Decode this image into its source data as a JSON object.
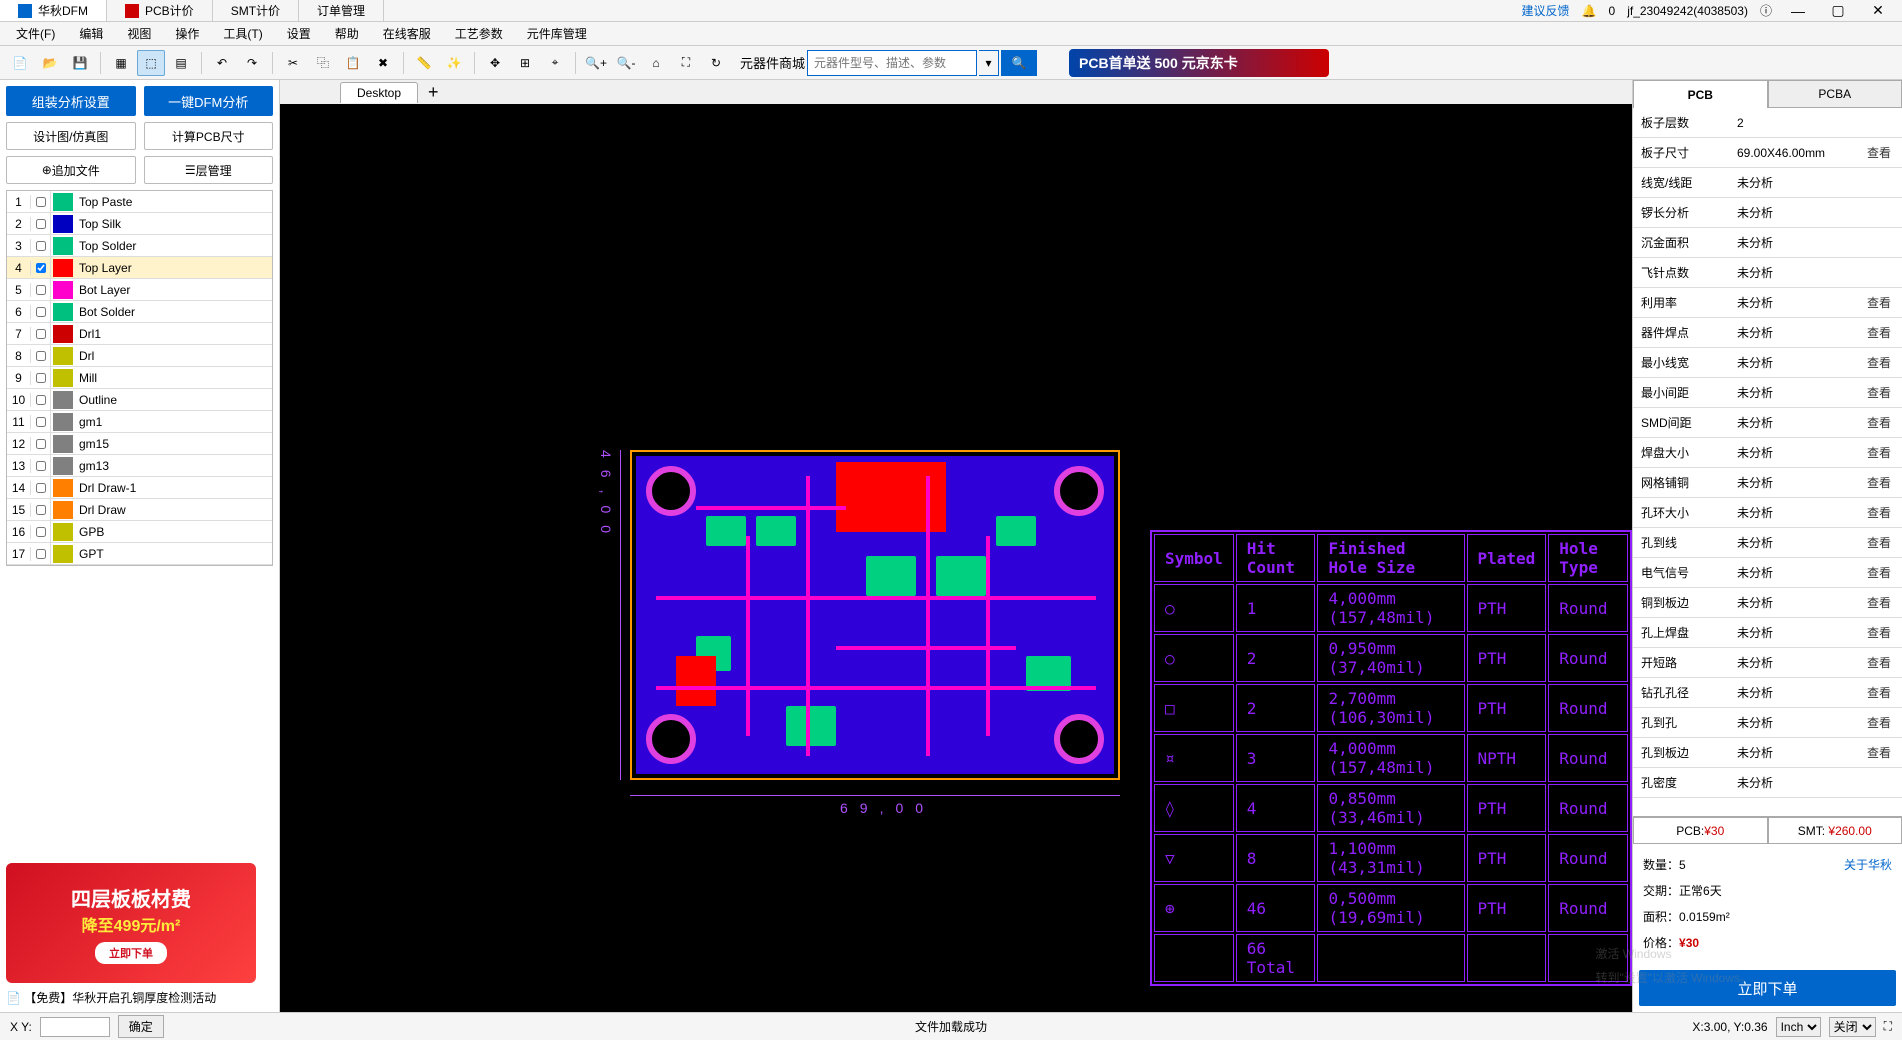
{
  "titlebar": {
    "tabs": [
      {
        "label": "华秋DFM",
        "icon": "blue"
      },
      {
        "label": "PCB计价",
        "icon": "red"
      },
      {
        "label": "SMT计价"
      },
      {
        "label": "订单管理"
      }
    ],
    "feedback": "建议反馈",
    "notif_count": "0",
    "user": "jf_23049242(4038503)"
  },
  "menus": [
    "文件(F)",
    "编辑",
    "视图",
    "操作",
    "工具(T)",
    "设置",
    "帮助",
    "在线客服",
    "工艺参数",
    "元件库管理"
  ],
  "toolbar": {
    "shop_label": "元器件商城",
    "search_placeholder": "元器件型号、描述、参数",
    "promo": "PCB首单送 500 元京东卡"
  },
  "left": {
    "btn1": "组装分析设置",
    "btn2": "一键DFM分析",
    "btn3": "设计图/仿真图",
    "btn4": "计算PCB尺寸",
    "add_file": "追加文件",
    "layer_mgr": "层管理",
    "layers": [
      {
        "n": "1",
        "name": "Top Paste",
        "c": "#00c080"
      },
      {
        "n": "2",
        "name": "Top Silk",
        "c": "#0000c0"
      },
      {
        "n": "3",
        "name": "Top Solder",
        "c": "#00c080"
      },
      {
        "n": "4",
        "name": "Top Layer",
        "c": "#ff0000",
        "active": true,
        "checked": true
      },
      {
        "n": "5",
        "name": "Bot Layer",
        "c": "#ff00cc"
      },
      {
        "n": "6",
        "name": "Bot Solder",
        "c": "#00c080"
      },
      {
        "n": "7",
        "name": "Drl1",
        "c": "#cc0000"
      },
      {
        "n": "8",
        "name": "Drl",
        "c": "#c0c000"
      },
      {
        "n": "9",
        "name": "Mill",
        "c": "#c0c000"
      },
      {
        "n": "10",
        "name": "Outline",
        "c": "#808080"
      },
      {
        "n": "11",
        "name": "gm1",
        "c": "#808080"
      },
      {
        "n": "12",
        "name": "gm15",
        "c": "#808080"
      },
      {
        "n": "13",
        "name": "gm13",
        "c": "#808080"
      },
      {
        "n": "14",
        "name": "Drl Draw-1",
        "c": "#ff8000"
      },
      {
        "n": "15",
        "name": "Drl Draw",
        "c": "#ff8000"
      },
      {
        "n": "16",
        "name": "GPB",
        "c": "#c0c000"
      },
      {
        "n": "17",
        "name": "GPT",
        "c": "#c0c000"
      }
    ],
    "ad_l1": "四层板板材费",
    "ad_l2": "降至499元/m²",
    "ad_btn": "立即下单",
    "ad_caption": "【免费】华秋开启孔铜厚度检测活动"
  },
  "viewport": {
    "tab": "Desktop",
    "dim_w": "69,00",
    "dim_h": "46,00",
    "drill": {
      "headers": [
        "Symbol",
        "Hit Count",
        "Finished Hole Size",
        "Plated",
        "Hole Type"
      ],
      "rows": [
        [
          "○",
          "1",
          "4,000mm (157,48mil)",
          "PTH",
          "Round"
        ],
        [
          "○",
          "2",
          "0,950mm (37,40mil)",
          "PTH",
          "Round"
        ],
        [
          "□",
          "2",
          "2,700mm (106,30mil)",
          "PTH",
          "Round"
        ],
        [
          "¤",
          "3",
          "4,000mm (157,48mil)",
          "NPTH",
          "Round"
        ],
        [
          "◊",
          "4",
          "0,850mm (33,46mil)",
          "PTH",
          "Round"
        ],
        [
          "▽",
          "8",
          "1,100mm (43,31mil)",
          "PTH",
          "Round"
        ],
        [
          "⊕",
          "46",
          "0,500mm (19,69mil)",
          "PTH",
          "Round"
        ],
        [
          "",
          "66 Total",
          "",
          "",
          ""
        ]
      ]
    }
  },
  "right": {
    "tab_pcb": "PCB",
    "tab_pcba": "PCBA",
    "props": [
      {
        "k": "板子层数",
        "v": "2"
      },
      {
        "k": "板子尺寸",
        "v": "69.00X46.00mm",
        "btn": "查看"
      },
      {
        "k": "线宽/线距",
        "v": "未分析"
      },
      {
        "k": "锣长分析",
        "v": "未分析"
      },
      {
        "k": "沉金面积",
        "v": "未分析"
      },
      {
        "k": "飞针点数",
        "v": "未分析"
      },
      {
        "k": "利用率",
        "v": "未分析",
        "btn": "查看"
      },
      {
        "k": "器件焊点",
        "v": "未分析",
        "btn": "查看"
      },
      {
        "k": "最小线宽",
        "v": "未分析",
        "btn": "查看"
      },
      {
        "k": "最小间距",
        "v": "未分析",
        "btn": "查看"
      },
      {
        "k": "SMD间距",
        "v": "未分析",
        "btn": "查看"
      },
      {
        "k": "焊盘大小",
        "v": "未分析",
        "btn": "查看"
      },
      {
        "k": "网格铺铜",
        "v": "未分析",
        "btn": "查看"
      },
      {
        "k": "孔环大小",
        "v": "未分析",
        "btn": "查看"
      },
      {
        "k": "孔到线",
        "v": "未分析",
        "btn": "查看"
      },
      {
        "k": "电气信号",
        "v": "未分析",
        "btn": "查看"
      },
      {
        "k": "铜到板边",
        "v": "未分析",
        "btn": "查看"
      },
      {
        "k": "孔上焊盘",
        "v": "未分析",
        "btn": "查看"
      },
      {
        "k": "开短路",
        "v": "未分析",
        "btn": "查看"
      },
      {
        "k": "钻孔孔径",
        "v": "未分析",
        "btn": "查看"
      },
      {
        "k": "孔到孔",
        "v": "未分析",
        "btn": "查看"
      },
      {
        "k": "孔到板边",
        "v": "未分析",
        "btn": "查看"
      },
      {
        "k": "孔密度",
        "v": "未分析"
      }
    ],
    "price_pcb_l": "PCB:",
    "price_pcb_v": "¥30",
    "price_smt_l": "SMT:",
    "price_smt_v": "¥260.00",
    "qty_l": "数量：",
    "qty_v": "5",
    "about": "关于华秋",
    "lead_l": "交期：",
    "lead_v": "正常6天",
    "area_l": "面积：",
    "area_v": "0.0159m²",
    "total_l": "价格：",
    "total_v": "¥30",
    "order_btn": "立即下单"
  },
  "status": {
    "xy": "X Y:",
    "ok": "确定",
    "msg": "文件加载成功",
    "coord": "X:3.00, Y:0.36",
    "unit": "Inch",
    "close": "关闭"
  },
  "watermark": {
    "l1": "激活 Windows",
    "l2": "转到\"设置\"以激活 Windows。"
  }
}
